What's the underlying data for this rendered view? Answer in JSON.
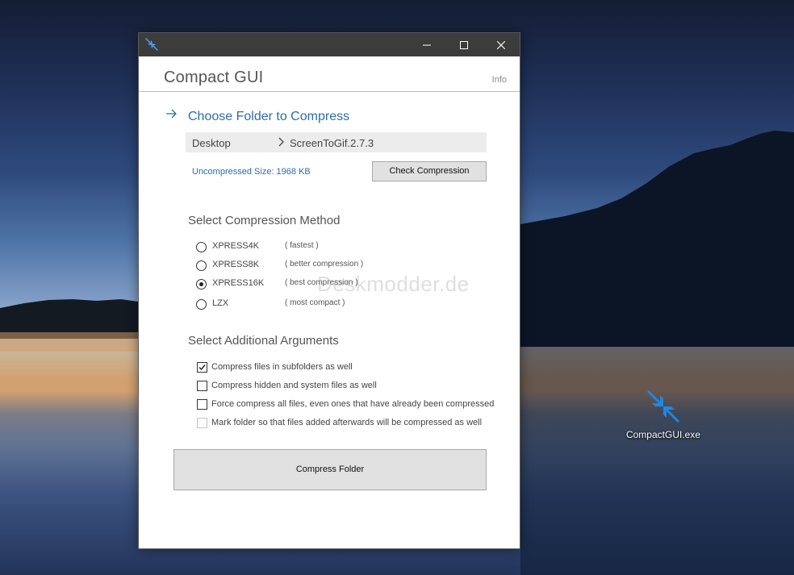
{
  "desktop": {
    "icon_label": "CompactGUI.exe",
    "accent_color": "#1e88e5"
  },
  "window": {
    "icon": "compact-arrows-icon",
    "caption_buttons": [
      "minimize-icon",
      "maximize-icon",
      "close-icon"
    ],
    "app_title": "Compact GUI",
    "info_label": "Info"
  },
  "folder": {
    "heading": "Choose Folder to Compress",
    "path_root": "Desktop",
    "path_separator_icon": "chevron-right-icon",
    "path_leaf": "ScreenToGif.2.7.3",
    "uncompressed_size": "Uncompressed Size: 1968 KB",
    "check_button": "Check Compression"
  },
  "method": {
    "heading": "Select Compression Method",
    "options": [
      {
        "label": "XPRESS4K",
        "desc": "( fastest )",
        "selected": false
      },
      {
        "label": "XPRESS8K",
        "desc": "( better compression )",
        "selected": false
      },
      {
        "label": "XPRESS16K",
        "desc": "( best compression )",
        "selected": true
      },
      {
        "label": "LZX",
        "desc": "( most compact )",
        "selected": false
      }
    ]
  },
  "arguments": {
    "heading": "Select Additional Arguments",
    "options": [
      {
        "label": "Compress files in subfolders as well",
        "checked": true,
        "enabled": true
      },
      {
        "label": "Compress hidden and system files as well",
        "checked": false,
        "enabled": true
      },
      {
        "label": "Force compress all files, even ones that have already been compressed",
        "checked": false,
        "enabled": true
      },
      {
        "label": "Mark folder so that files added afterwards will be compressed as well",
        "checked": false,
        "enabled": false
      }
    ]
  },
  "actions": {
    "compress_button": "Compress Folder"
  },
  "watermark": "Deskmodder.de",
  "colors": {
    "accent_blue": "#2f6ca8",
    "titlebar": "#3c3c3c",
    "button_face": "#e1e1e1"
  }
}
